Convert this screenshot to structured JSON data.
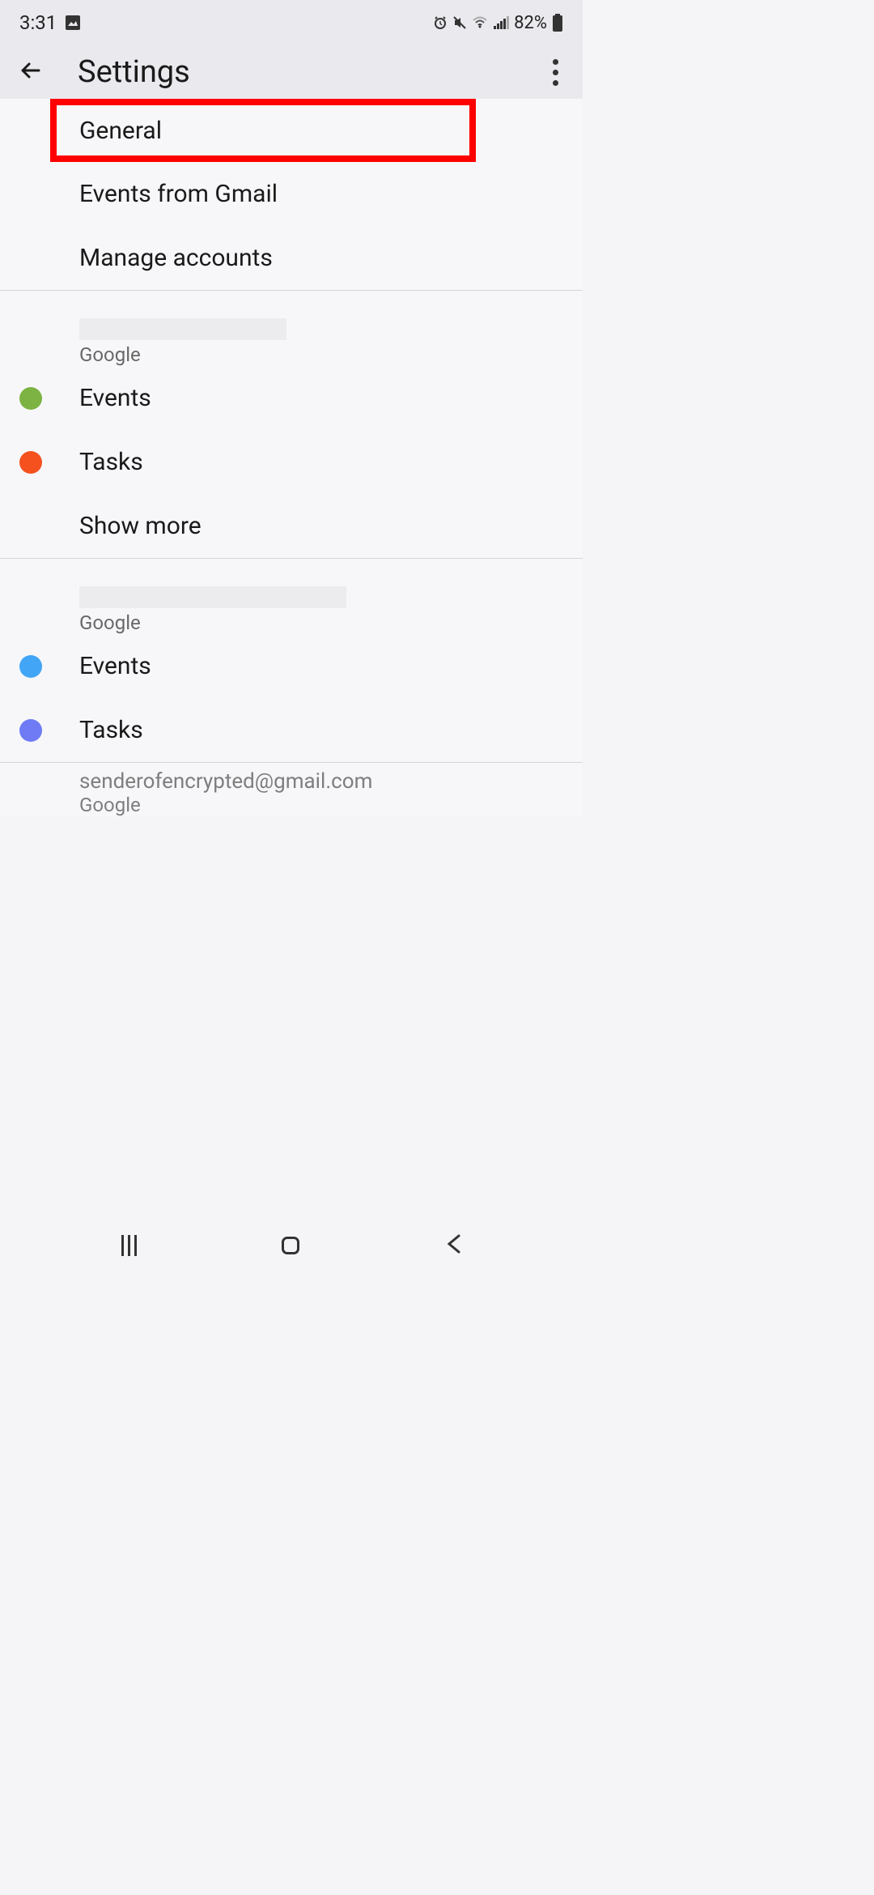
{
  "status_bar": {
    "time": "3:31",
    "battery": "82%"
  },
  "app_bar": {
    "title": "Settings"
  },
  "top_items": {
    "general": "General",
    "events_gmail": "Events from Gmail",
    "manage_accounts": "Manage accounts"
  },
  "accounts": [
    {
      "provider": "Google",
      "events": "Events",
      "tasks": "Tasks",
      "show_more": "Show more"
    },
    {
      "provider": "Google",
      "events": "Events",
      "tasks": "Tasks"
    }
  ],
  "partial": {
    "email": "senderofencrypted@gmail.com",
    "provider": "Google"
  },
  "colors": {
    "dot_green": "#7cb342",
    "dot_orange": "#f4511e",
    "dot_blue": "#42a5f5",
    "dot_purple": "#6e7bf5",
    "highlight": "#ff0000"
  }
}
